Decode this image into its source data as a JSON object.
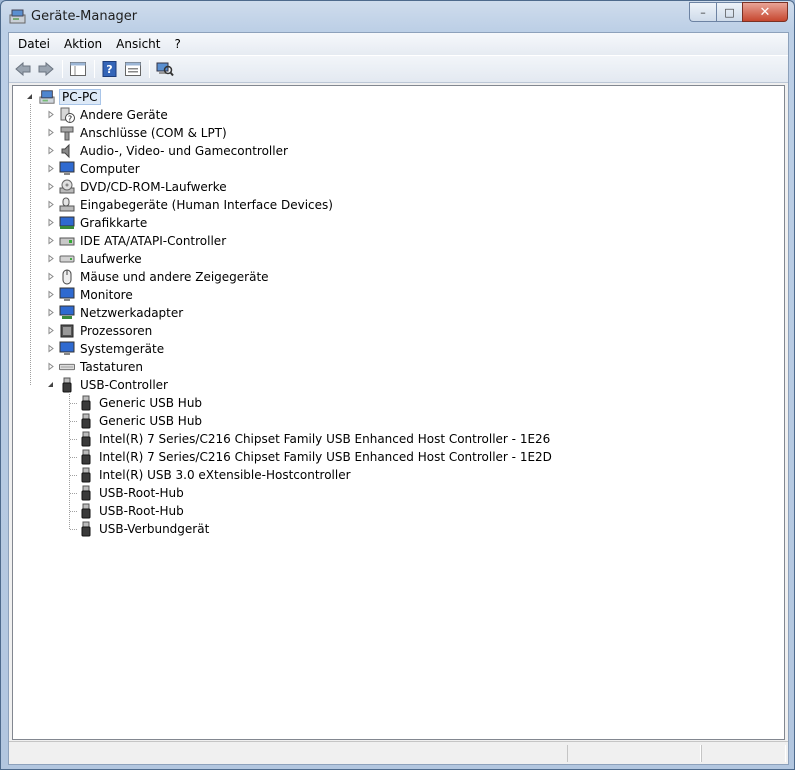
{
  "window": {
    "title": "Geräte-Manager",
    "icon": "device-manager-icon"
  },
  "caption": {
    "minimize": "–",
    "maximize": "□",
    "close": "✕"
  },
  "menu": [
    {
      "label": "Datei"
    },
    {
      "label": "Aktion"
    },
    {
      "label": "Ansicht"
    },
    {
      "label": "?"
    }
  ],
  "toolbar": [
    {
      "name": "back-arrow-icon"
    },
    {
      "name": "forward-arrow-icon"
    },
    {
      "name": "console-tree-icon"
    },
    {
      "name": "help-icon"
    },
    {
      "name": "properties-view-icon"
    },
    {
      "name": "scan-hardware-icon"
    }
  ],
  "tree": {
    "root": {
      "label": "PC-PC",
      "icon": "computer-icon",
      "expanded": true
    },
    "categories": [
      {
        "label": "Andere Geräte",
        "icon": "unknown-device-icon",
        "expanded": false
      },
      {
        "label": "Anschlüsse (COM & LPT)",
        "icon": "port-icon",
        "expanded": false
      },
      {
        "label": "Audio-, Video- und Gamecontroller",
        "icon": "speaker-icon",
        "expanded": false
      },
      {
        "label": "Computer",
        "icon": "monitor-icon",
        "expanded": false
      },
      {
        "label": "DVD/CD-ROM-Laufwerke",
        "icon": "disc-drive-icon",
        "expanded": false
      },
      {
        "label": "Eingabegeräte (Human Interface Devices)",
        "icon": "hid-icon",
        "expanded": false
      },
      {
        "label": "Grafikkarte",
        "icon": "display-adapter-icon",
        "expanded": false
      },
      {
        "label": "IDE ATA/ATAPI-Controller",
        "icon": "ide-controller-icon",
        "expanded": false
      },
      {
        "label": "Laufwerke",
        "icon": "disk-drive-icon",
        "expanded": false
      },
      {
        "label": "Mäuse und andere Zeigegeräte",
        "icon": "mouse-icon",
        "expanded": false
      },
      {
        "label": "Monitore",
        "icon": "monitor-icon",
        "expanded": false
      },
      {
        "label": "Netzwerkadapter",
        "icon": "network-adapter-icon",
        "expanded": false
      },
      {
        "label": "Prozessoren",
        "icon": "processor-icon",
        "expanded": false
      },
      {
        "label": "Systemgeräte",
        "icon": "system-device-icon",
        "expanded": false
      },
      {
        "label": "Tastaturen",
        "icon": "keyboard-icon",
        "expanded": false
      },
      {
        "label": "USB-Controller",
        "icon": "usb-icon",
        "expanded": true,
        "children": [
          {
            "label": "Generic USB Hub"
          },
          {
            "label": "Generic USB Hub"
          },
          {
            "label": "Intel(R) 7 Series/C216 Chipset Family USB Enhanced Host Controller - 1E26"
          },
          {
            "label": "Intel(R) 7 Series/C216 Chipset Family USB Enhanced Host Controller - 1E2D"
          },
          {
            "label": "Intel(R) USB 3.0 eXtensible-Hostcontroller"
          },
          {
            "label": "USB-Root-Hub"
          },
          {
            "label": "USB-Root-Hub"
          },
          {
            "label": "USB-Verbundgerät"
          }
        ]
      }
    ]
  },
  "statusbar": {
    "panes": [
      "",
      "",
      ""
    ]
  }
}
